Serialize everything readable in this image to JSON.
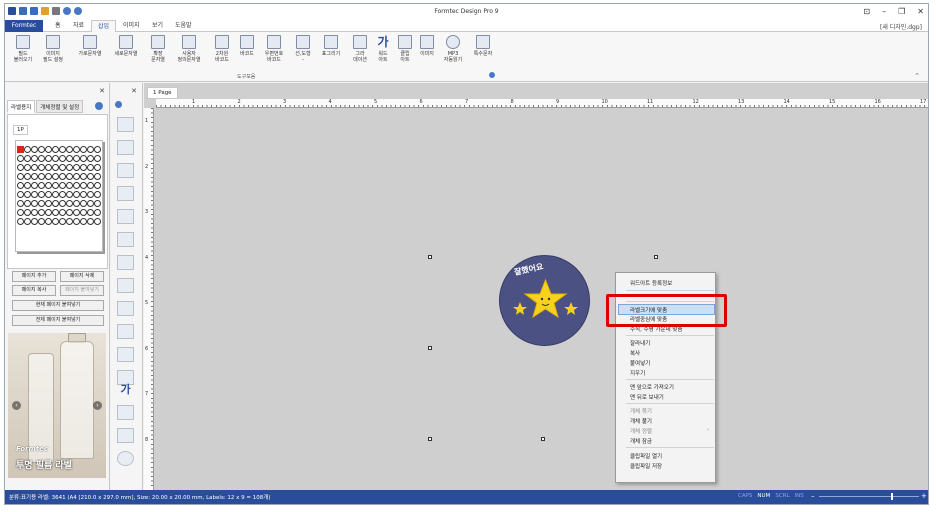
{
  "window": {
    "title": "Formtec Design Pro 9",
    "document_name": "[새 디자인.dgp]",
    "controls": [
      "⊡",
      "–",
      "❐",
      "✕"
    ]
  },
  "menu": {
    "file": "Formtec",
    "tabs": [
      "홈",
      "자료",
      "삽입",
      "이미지",
      "보기",
      "도움말"
    ],
    "active": "삽입"
  },
  "ribbon": {
    "buttons": [
      {
        "label": "필드\n불러오기",
        "icon": "field-load-icon"
      },
      {
        "label": "이미지\n필드 설정",
        "icon": "image-field-icon"
      },
      {
        "label": "가로문자열",
        "icon": "horizontal-text-icon"
      },
      {
        "label": "세로문자열",
        "icon": "vertical-text-icon"
      },
      {
        "label": "확장\n문자열",
        "icon": "extended-text-icon"
      },
      {
        "label": "사용자\n정의문자열",
        "icon": "custom-text-icon"
      },
      {
        "label": "2차원\n바코드",
        "icon": "qr-code-icon"
      },
      {
        "label": "바코드",
        "icon": "barcode-icon"
      },
      {
        "label": "우편번호\n바코드",
        "icon": "postal-barcode-icon"
      },
      {
        "label": "선,도형\n-",
        "icon": "shapes-icon"
      },
      {
        "label": "표그리기",
        "icon": "table-icon"
      },
      {
        "label": "그라\n데이션",
        "icon": "gradient-icon"
      },
      {
        "label": "워드\n아트",
        "icon": "word-art-icon"
      },
      {
        "label": "클립\n아트",
        "icon": "clip-art-icon"
      },
      {
        "label": "이미지",
        "icon": "image-icon"
      },
      {
        "label": "MP3\n자동읽기",
        "icon": "mp3-icon"
      },
      {
        "label": "특수문자",
        "icon": "special-char-icon"
      }
    ],
    "group_label": "도구모음"
  },
  "left_panel": {
    "tabs": [
      "라벨용지",
      "개체정렬 및 설정"
    ],
    "page_tab": "1P",
    "buttons": {
      "add_page": "페이지 추가",
      "delete_page": "페이지 삭제",
      "copy_page": "페이지 복사",
      "paste_page": "페이지 붙여넣기",
      "paste_current": "현재 페이지 붙여넣기",
      "paste_all": "전체 페이지 붙여넣기"
    },
    "ad": {
      "brand": "Formtec",
      "text": "투명 필름 라벨"
    }
  },
  "tool_column": {
    "tools": [
      "check-tool-icon",
      "image-field-tool-icon",
      "text-tool-icon",
      "vertical-text-tool-icon",
      "extended-text-tool-icon",
      "custom-text-tool-icon",
      "barcode-tool-icon",
      "postal-barcode-tool-icon",
      "shape-tool-icon",
      "table-tool-icon",
      "gradient-tool-icon",
      "word-art-tool-icon",
      "clip-art-tool-icon",
      "image-tool-icon",
      "mp3-tool-icon"
    ],
    "word_art_glyph": "가"
  },
  "document": {
    "page_tab": "1 Page",
    "h_ruler_numbers": [
      "1",
      "2",
      "3",
      "4",
      "5",
      "6",
      "7",
      "8",
      "9",
      "10",
      "11",
      "12",
      "13",
      "14",
      "15",
      "16",
      "17"
    ],
    "v_ruler_numbers": [
      "1",
      "2",
      "3",
      "4",
      "5",
      "6",
      "7",
      "8"
    ],
    "label_text": "잘했어요",
    "label_colors": {
      "circle": "#4b5283",
      "star": "#f7d21d"
    }
  },
  "context_menu": {
    "items": [
      {
        "label": "워드아트 등록정보",
        "enabled": true
      },
      {
        "label": "라벨크기에 맞춤",
        "enabled": true,
        "highlighted": true
      },
      {
        "label": "라벨중심에 맞춤",
        "enabled": true
      },
      {
        "label": "수직, 수평 가운데 맞춤",
        "enabled": true
      },
      {
        "label": "잘라내기",
        "enabled": true
      },
      {
        "label": "복사",
        "enabled": true
      },
      {
        "label": "붙여넣기",
        "enabled": true
      },
      {
        "label": "지우기",
        "enabled": true
      },
      {
        "label": "맨 앞으로 가져오기",
        "enabled": true
      },
      {
        "label": "맨 뒤로 보내기",
        "enabled": true
      },
      {
        "label": "개체 묶기",
        "enabled": false
      },
      {
        "label": "개체 풀기",
        "enabled": true
      },
      {
        "label": "개체 정렬",
        "enabled": false,
        "submenu": true
      },
      {
        "label": "개체 잠금",
        "enabled": true
      },
      {
        "label": "클립파일 열기",
        "enabled": true
      },
      {
        "label": "클립파일 저장",
        "enabled": true
      }
    ]
  },
  "status_bar": {
    "text": "분류:표기용 라벨: 3641 (A4 [210.0 x 297.0 mm], Size: 20.00 x 20.00 mm,  Labels: 12 x 9 = 108개)",
    "keys": [
      {
        "label": "CAPS",
        "on": false
      },
      {
        "label": "NUM",
        "on": true
      },
      {
        "label": "SCRL",
        "on": false
      },
      {
        "label": "INS",
        "on": false
      }
    ],
    "zoom_minus": "–",
    "zoom_plus": "+",
    "zoom_level": 0.72
  }
}
